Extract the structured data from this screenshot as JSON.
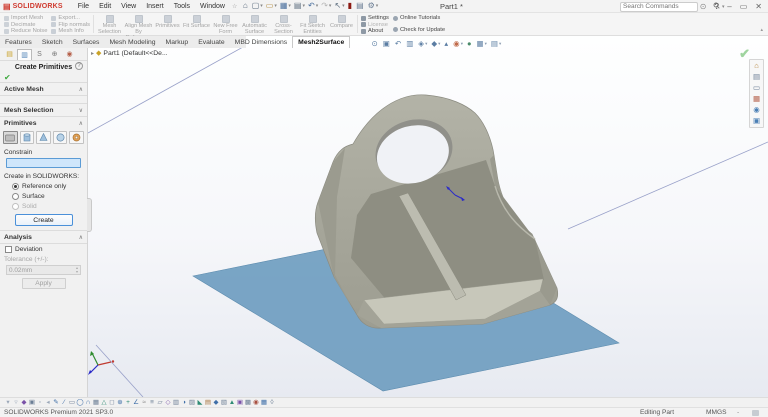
{
  "window": {
    "title": "Part1 *",
    "brand": "SOLIDWORKS",
    "brand_mark": "◤S",
    "search_placeholder": "Search Commands",
    "controls": {
      "help": "?",
      "minimize": "–",
      "maximize": "▭",
      "close": "✕"
    }
  },
  "menubar": {
    "menus": [
      "File",
      "Edit",
      "View",
      "Insert",
      "Tools",
      "Window"
    ],
    "pin_icon": "☆"
  },
  "quick_access": [
    {
      "g": "⌂",
      "c": "#5a6b7d"
    },
    {
      "g": "▢",
      "c": "#5a6b7d",
      "caret": "▾"
    },
    {
      "g": "▭",
      "c": "#b08a3e",
      "caret": "▾"
    },
    {
      "g": "▦",
      "c": "#4a6f9d",
      "caret": "▾"
    },
    {
      "g": "▤",
      "c": "#5a6b7d",
      "caret": "▾"
    },
    {
      "g": "↶",
      "c": "#4a6f9d",
      "caret": "▾"
    },
    {
      "g": "↷",
      "c": "#b5b5b5",
      "caret": "▾"
    },
    {
      "g": "↖",
      "c": "#5a6b7d",
      "caret": "▾"
    },
    {
      "g": "▮",
      "c": "#8b1a12"
    },
    {
      "g": "▤",
      "c": "#6b7e95"
    },
    {
      "g": "⚙",
      "c": "#6b7e95",
      "caret": "▾"
    }
  ],
  "ribbon": {
    "col1": [
      "Import Mesh",
      "Decimate",
      "Reduce Noise"
    ],
    "col2": [
      "Export...",
      "Flip normals",
      "Mesh Info"
    ],
    "large_buttons": [
      "Mesh Selection",
      "Align Mesh By Reference",
      "Primitives",
      "Fit Surface",
      "New Free Form",
      "Automatic Surface",
      "Cross-Section",
      "Fit Sketch Entities",
      "Compare"
    ],
    "settings_col": [
      {
        "label": "Settings"
      },
      {
        "label": "License",
        "disabled": true
      },
      {
        "label": "About"
      }
    ],
    "links_col": [
      {
        "label": "Online Tutorials"
      },
      {
        "label": "Check for Update"
      }
    ],
    "collapse_icon": "▴"
  },
  "tabs": [
    {
      "label": "Features"
    },
    {
      "label": "Sketch"
    },
    {
      "label": "Surfaces"
    },
    {
      "label": "Mesh Modeling"
    },
    {
      "label": "Markup"
    },
    {
      "label": "Evaluate"
    },
    {
      "label": "MBD Dimensions"
    },
    {
      "label": "Mesh2Surface",
      "active": true
    }
  ],
  "pm_tabs": [
    {
      "g": "▤",
      "c": "#c9a227"
    },
    {
      "g": "▥",
      "c": "#4a7fb5",
      "active": true
    },
    {
      "g": "S",
      "c": "#777777"
    },
    {
      "g": "⊕",
      "c": "#777777"
    },
    {
      "g": "◉",
      "c": "#b5604a"
    }
  ],
  "panel": {
    "title": "Create Primitives",
    "help": "?",
    "ok_mark": "✔",
    "sections": {
      "active_mesh": {
        "title": "Active Mesh",
        "caret": "∧"
      },
      "mesh_selection": {
        "title": "Mesh Selection",
        "caret": "∨"
      },
      "primitives": {
        "title": "Primitives",
        "caret": "∧"
      },
      "analysis": {
        "title": "Analysis",
        "caret": "∧"
      }
    },
    "constrain_label": "Constrain",
    "create_in_label": "Create in SOLIDWORKS:",
    "radios": [
      {
        "label": "Reference only",
        "selected": true
      },
      {
        "label": "Surface"
      },
      {
        "label": "Solid",
        "disabled": true
      }
    ],
    "create_button": "Create",
    "deviation_label": "Deviation",
    "tolerance_label": "Tolerance (+/-):",
    "tolerance_value": "0.02mm",
    "apply_button": "Apply"
  },
  "viewport": {
    "tree_item": "Part1  (Default<<De...",
    "flyout": "▸",
    "hud": [
      {
        "g": "⊙"
      },
      {
        "g": "▣"
      },
      {
        "g": "↶"
      },
      {
        "g": "▥"
      },
      {
        "g": "◈",
        "caret": "▾"
      },
      {
        "g": "◆",
        "caret": "▾"
      },
      {
        "g": "▴"
      },
      {
        "g": "◉",
        "caret": "▾",
        "c": "#c06a4a"
      },
      {
        "g": "●",
        "c": "#4a8a6a"
      },
      {
        "g": "▦",
        "caret": "▾"
      },
      {
        "g": "▤",
        "caret": "▾"
      }
    ],
    "confirm_mark": "✔",
    "taskpane_icons": [
      {
        "g": "⌂",
        "c": "#b5843c"
      },
      {
        "g": "▤",
        "c": "#6b7e95"
      },
      {
        "g": "▭",
        "c": "#6b7e95"
      },
      {
        "g": "▦",
        "c": "#b5604a"
      },
      {
        "g": "◉",
        "c": "#4a7fb5"
      },
      {
        "g": "▣",
        "c": "#4a7fb5"
      }
    ]
  },
  "lower_toolbar": [
    {
      "g": "▾",
      "c": "#9aa7b8"
    },
    {
      "g": "▿",
      "c": "#9aa7b8"
    },
    {
      "g": "◆",
      "c": "#7a52a8"
    },
    {
      "g": "▣",
      "c": "#6b7e95"
    },
    {
      "g": "▫",
      "c": "#9aa7b8"
    },
    {
      "g": "◂",
      "c": "#9aa7b8"
    },
    {
      "g": "✎",
      "c": "#3f6fa8"
    },
    {
      "g": "∕",
      "c": "#3f6fa8"
    },
    {
      "g": "▭",
      "c": "#6b7e95"
    },
    {
      "g": "◯",
      "c": "#3f6fa8"
    },
    {
      "g": "∩",
      "c": "#3f6fa8"
    },
    {
      "g": "▦",
      "c": "#6b7e95"
    },
    {
      "g": "△",
      "c": "#2e8b74"
    },
    {
      "g": "◻",
      "c": "#6b7e95"
    },
    {
      "g": "⊕",
      "c": "#3f6fa8"
    },
    {
      "g": "+",
      "c": "#2e8b74"
    },
    {
      "g": "∠",
      "c": "#3f6fa8"
    },
    {
      "g": "≈",
      "c": "#888888"
    },
    {
      "g": "≡",
      "c": "#6b7e95"
    },
    {
      "g": "▱",
      "c": "#6b7e95"
    },
    {
      "g": "◇",
      "c": "#7a52a8"
    },
    {
      "g": "▥",
      "c": "#6b7e95"
    },
    {
      "g": "◑",
      "c": "#3f6fa8"
    },
    {
      "g": "▨",
      "c": "#6b7e95"
    },
    {
      "g": "◣",
      "c": "#2e8b74"
    },
    {
      "g": "▤",
      "c": "#a8743f"
    },
    {
      "g": "◆",
      "c": "#3f6fa8"
    },
    {
      "g": "▧",
      "c": "#6b7e95"
    },
    {
      "g": "▲",
      "c": "#2e8b74"
    },
    {
      "g": "▣",
      "c": "#7a52a8"
    },
    {
      "g": "▩",
      "c": "#6b7e95"
    },
    {
      "g": "◉",
      "c": "#a84f3f"
    },
    {
      "g": "▦",
      "c": "#3f6fa8"
    },
    {
      "g": "◊",
      "c": "#6b7e95"
    }
  ],
  "statusbar": {
    "left": "SOLIDWORKS Premium 2021 SP3.0",
    "mode": "Editing Part",
    "units": "MMGS",
    "dash": "-"
  },
  "colors": {
    "brand_red": "#cf3a2f",
    "accent_blue": "#4a90d9",
    "plane_blue": "#6f9dc0",
    "plane_edge": "#5d8cae",
    "model_gray": "#a6a69a",
    "model_dark": "#8d8d81",
    "model_light": "#c7c7ba",
    "ref_line": "#99a1c9",
    "check_green": "#9fd49f"
  }
}
